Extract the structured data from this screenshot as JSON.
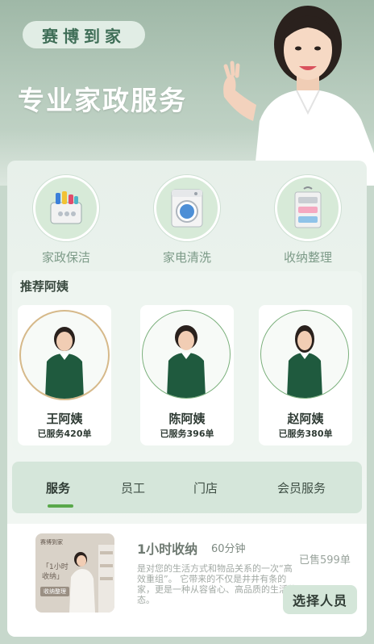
{
  "brand": {
    "name": "赛博到家"
  },
  "hero": {
    "title": "专业家政服务"
  },
  "services": [
    {
      "label": "家政保洁",
      "icon": "cleaning-basket-icon"
    },
    {
      "label": "家电清洗",
      "icon": "washing-machine-icon"
    },
    {
      "label": "收纳整理",
      "icon": "hanging-organizer-icon"
    }
  ],
  "recommend": {
    "title": "推荐阿姨",
    "items": [
      {
        "name": "王阿姨",
        "count": "已服务420单"
      },
      {
        "name": "陈阿姨",
        "count": "已服务396单"
      },
      {
        "name": "赵阿姨",
        "count": "已服务380单"
      }
    ]
  },
  "tabs": [
    {
      "label": "服务",
      "active": true
    },
    {
      "label": "员工",
      "active": false
    },
    {
      "label": "门店",
      "active": false
    },
    {
      "label": "会员服务",
      "active": false
    }
  ],
  "service_item": {
    "title": "1小时收纳",
    "duration": "60分钟",
    "sold": "已售599单",
    "description": "是对您的生活方式和物品关系的一次“高效重组”。 它带来的不仅是井井有条的家，更是一种从容省心、高品质的生活状态。",
    "button": "选择人员",
    "thumb_brand": "赛博到家",
    "thumb_line1": "「1小时",
    "thumb_line2": "收纳」",
    "thumb_tag": "收纳整理"
  },
  "colors": {
    "accent_green": "#59a84a",
    "uniform_green": "#1f5a3e",
    "card_bg": "#eef5f0"
  }
}
